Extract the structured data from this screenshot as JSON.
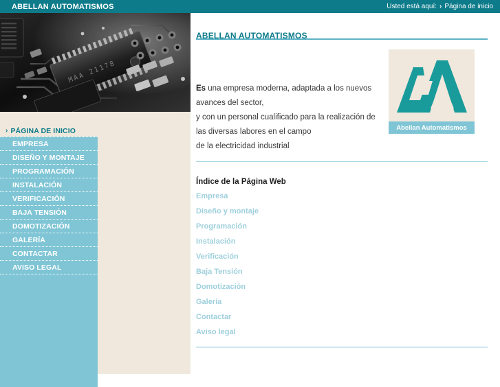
{
  "topbar": {
    "site_title": "ABELLAN AUTOMATISMOS",
    "breadcrumb_label": "Usted está aquí:",
    "breadcrumb_chevron": "›",
    "breadcrumb_current": "Página de inicio"
  },
  "hero": {
    "icon": "circuit-board-photo",
    "alt": "Fotografía en blanco y negro de una placa de circuito impreso con un microchip"
  },
  "sidebar": {
    "home": {
      "label": "PÁGINA DE INICIO",
      "chevron": "›"
    },
    "items": [
      {
        "label": "EMPRESA"
      },
      {
        "label": "DISEÑO Y MONTAJE"
      },
      {
        "label": "PROGRAMACIÓN"
      },
      {
        "label": "INSTALACIÓN"
      },
      {
        "label": "VERIFICACIÓN"
      },
      {
        "label": "BAJA TENSIÓN"
      },
      {
        "label": "DOMOTIZACIÓN"
      },
      {
        "label": "GALERÍA"
      },
      {
        "label": "CONTACTAR"
      },
      {
        "label": "AVISO LEGAL"
      }
    ]
  },
  "main": {
    "title": "ABELLAN AUTOMATISMOS",
    "intro": {
      "lead": "Es",
      "lines": [
        " una empresa moderna, adaptada a los nuevos avances del sector,",
        "y con un personal cualificado para la realización de las diversas labores en el campo",
        "de la electricidad industrial"
      ]
    },
    "logo": {
      "icon": "aa-monogram-logo",
      "caption": "Abellan Automatismos"
    },
    "index": {
      "title": "Índice de la Página Web",
      "links": [
        {
          "label": "Empresa"
        },
        {
          "label": "Diseño y montaje"
        },
        {
          "label": "Programación"
        },
        {
          "label": "Instalación"
        },
        {
          "label": "Verificación"
        },
        {
          "label": "Baja Tensión"
        },
        {
          "label": "Domotización"
        },
        {
          "label": "Galería"
        },
        {
          "label": "Contactar"
        },
        {
          "label": "Aviso legal"
        }
      ]
    }
  },
  "colors": {
    "header_teal": "#0d7b8a",
    "sidebar_blue": "#7fc5d5",
    "cream": "#f0e8dc",
    "link_blue": "#9fd0dd",
    "rule_teal": "#5bb2c4"
  }
}
